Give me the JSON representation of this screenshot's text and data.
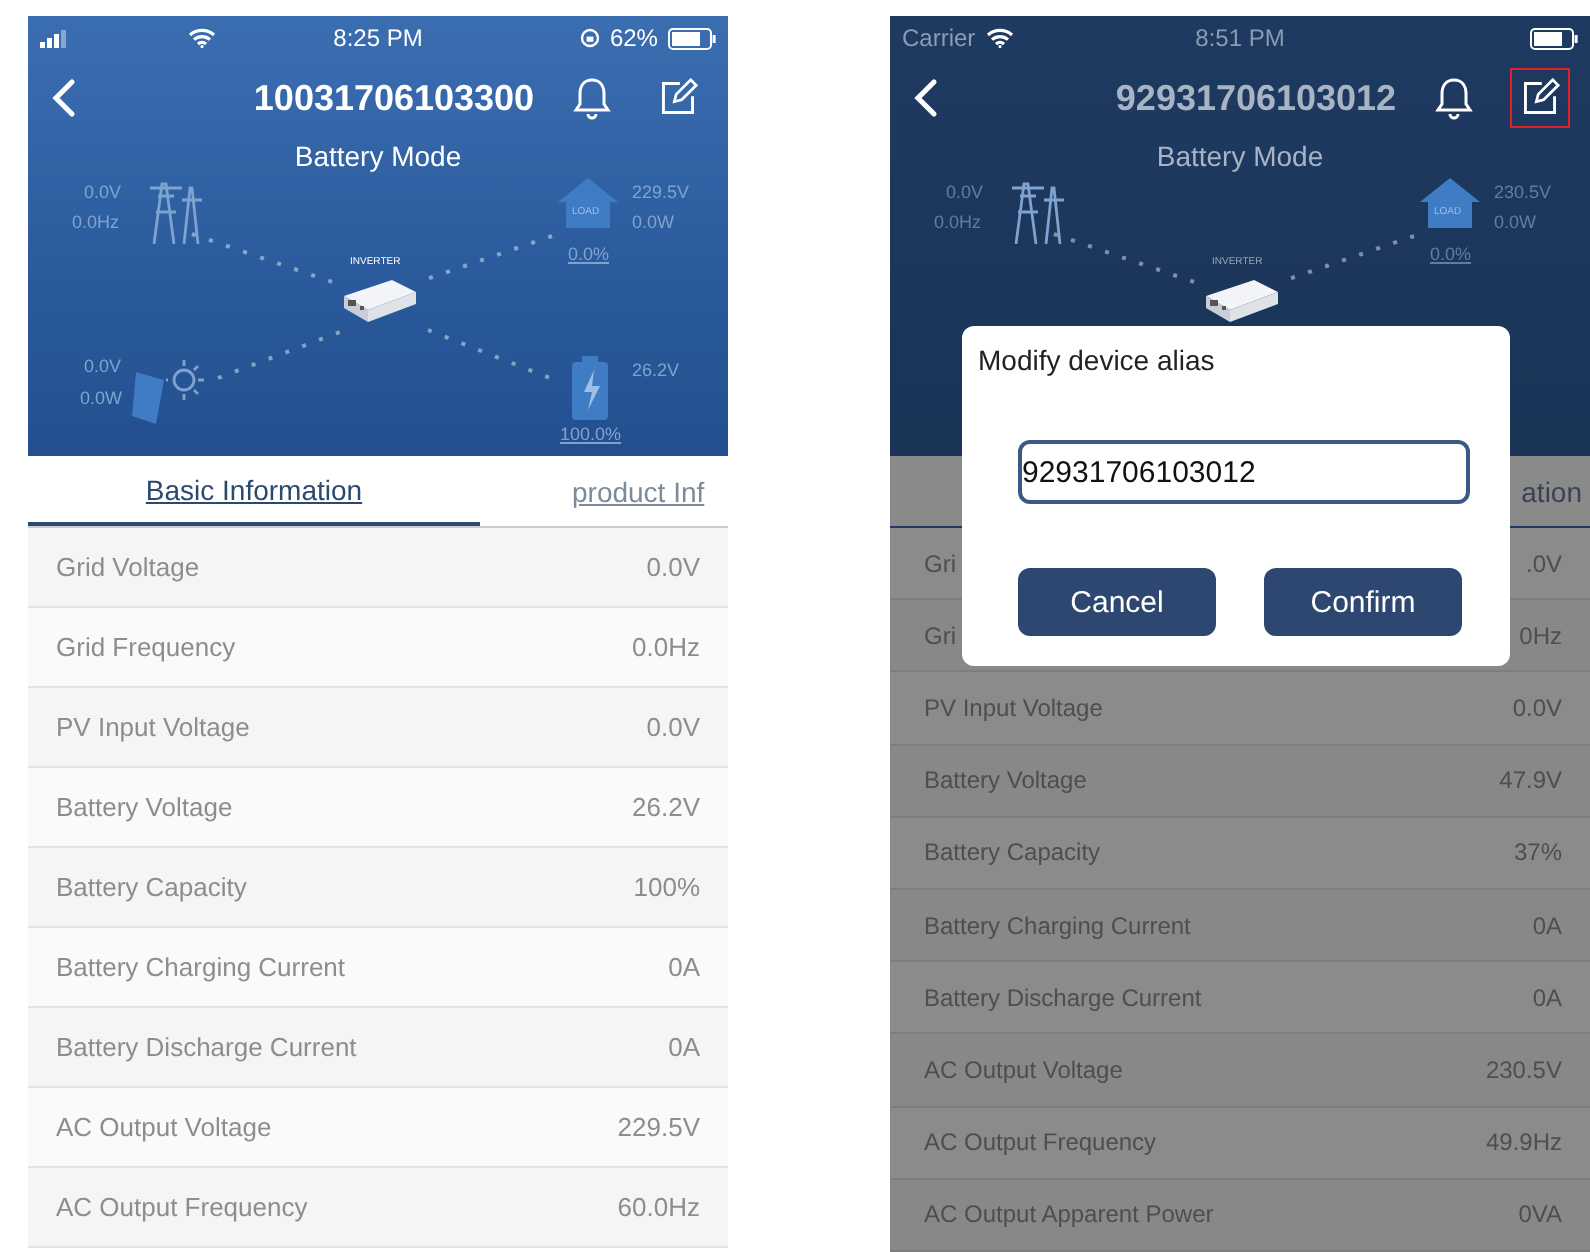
{
  "screens": [
    {
      "dimmed": false,
      "status_bar": {
        "time": "8:25 PM",
        "battery": "62%"
      },
      "title": "10031706103300",
      "edit_highlighted": false,
      "subtitle": "Battery Mode",
      "diagram": {
        "grid": [
          "0.0V",
          "0.0Hz"
        ],
        "load": [
          "229.5V",
          "0.0W"
        ],
        "load_tag": "LOAD",
        "load_percent": "0.0%",
        "inverter_label": "INVERTER",
        "solar": [
          "0.0V",
          "0.0W"
        ],
        "battery": [
          "26.2V"
        ],
        "battery_percent": "100.0%"
      },
      "tabs": [
        {
          "label": "Basic Information",
          "selected": true
        },
        {
          "label": "product Inf",
          "selected": false
        }
      ],
      "rows": [
        {
          "label": "Grid Voltage",
          "value": "0.0V"
        },
        {
          "label": "Grid Frequency",
          "value": "0.0Hz"
        },
        {
          "label": "PV Input Voltage",
          "value": "0.0V"
        },
        {
          "label": "Battery Voltage",
          "value": "26.2V"
        },
        {
          "label": "Battery Capacity",
          "value": "100%"
        },
        {
          "label": "Battery Charging Current",
          "value": "0A"
        },
        {
          "label": "Battery Discharge Current",
          "value": "0A"
        },
        {
          "label": "AC Output Voltage",
          "value": "229.5V"
        },
        {
          "label": "AC Output Frequency",
          "value": "60.0Hz"
        }
      ]
    },
    {
      "dimmed": true,
      "status_bar": {
        "carrier": "Carrier",
        "time": "8:51 PM"
      },
      "title": "92931706103012",
      "edit_highlighted": true,
      "subtitle": "Battery Mode",
      "diagram": {
        "grid": [
          "0.0V",
          "0.0Hz"
        ],
        "load": [
          "230.5V",
          "0.0W"
        ],
        "load_tag": "LOAD",
        "load_percent": "0.0%",
        "inverter_label": "INVERTER"
      },
      "tabs": [
        {
          "label": "ation",
          "selected": false
        }
      ],
      "rows": [
        {
          "label": "Gri",
          "value": ".0V"
        },
        {
          "label": "Gri",
          "value": "0Hz"
        },
        {
          "label": "PV Input Voltage",
          "value": "0.0V"
        },
        {
          "label": "Battery Voltage",
          "value": "47.9V"
        },
        {
          "label": "Battery Capacity",
          "value": "37%"
        },
        {
          "label": "Battery Charging Current",
          "value": "0A"
        },
        {
          "label": "Battery Discharge Current",
          "value": "0A"
        },
        {
          "label": "AC Output Voltage",
          "value": "230.5V"
        },
        {
          "label": "AC Output Frequency",
          "value": "49.9Hz"
        },
        {
          "label": "AC Output Apparent Power",
          "value": "0VA"
        }
      ],
      "dialog": {
        "title": "Modify device alias",
        "value": "92931706103012",
        "buttons": [
          "Cancel",
          "Confirm"
        ]
      }
    }
  ]
}
